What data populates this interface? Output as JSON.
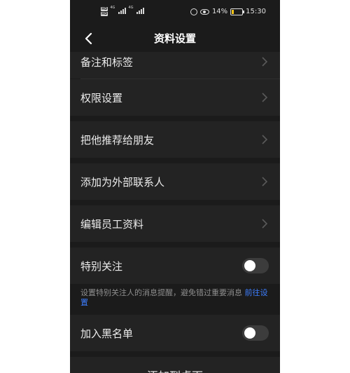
{
  "status_bar": {
    "sim1_label": "HD",
    "sim2_label": "HD",
    "net1": "4G",
    "net2": "4G",
    "battery": "14%",
    "time": "15:30"
  },
  "header": {
    "title": "资料设置",
    "back_icon": "chevron-left-icon"
  },
  "rows": {
    "remark_tags": "备注和标签",
    "permissions": "权限设置",
    "recommend": "把他推荐给朋友",
    "add_external": "添加为外部联系人",
    "edit_employee": "编辑员工资料",
    "special_follow": "特别关注",
    "blacklist": "加入黑名单",
    "add_desktop": "添加到桌面"
  },
  "special_follow_hint": {
    "text": "设置特别关注人的消息提醒，避免错过重要消息 ",
    "link": "前往设置"
  },
  "toggles": {
    "special_follow_on": false,
    "blacklist_on": false
  },
  "colors": {
    "background": "#1b1b1b",
    "row": "#232323",
    "link": "#3d7eff"
  }
}
